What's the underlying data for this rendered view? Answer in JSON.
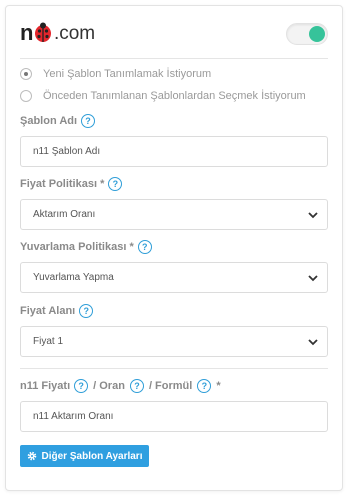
{
  "header": {
    "logo_prefix": "n",
    "logo_suffix": ".com",
    "logo_alt": "n11.com",
    "toggle_on": true,
    "toggle_color": "#36c39a"
  },
  "radios": [
    {
      "label": "Yeni Şablon Tanımlamak İstiyorum",
      "checked": true
    },
    {
      "label": "Önceden Tanımlanan Şablonlardan Seçmek İstiyorum",
      "checked": false
    }
  ],
  "fields": {
    "template_name": {
      "label": "Şablon Adı",
      "value": "n11 Şablon Adı"
    },
    "price_policy": {
      "label": "Fiyat Politikası *",
      "selected": "Aktarım Oranı"
    },
    "rounding_policy": {
      "label": "Yuvarlama Politikası *",
      "selected": "Yuvarlama Yapma"
    },
    "price_field": {
      "label": "Fiyat Alanı",
      "selected": "Fiyat 1"
    },
    "formula": {
      "label_part1": "n11 Fiyatı",
      "label_part2": "/ Oran",
      "label_part3": "/ Formül",
      "required_mark": "*",
      "value": "n11 Aktarım Oranı"
    }
  },
  "help_glyph": "?",
  "button": {
    "label": "Diğer Şablon Ayarları",
    "color": "#2f9fe0"
  }
}
